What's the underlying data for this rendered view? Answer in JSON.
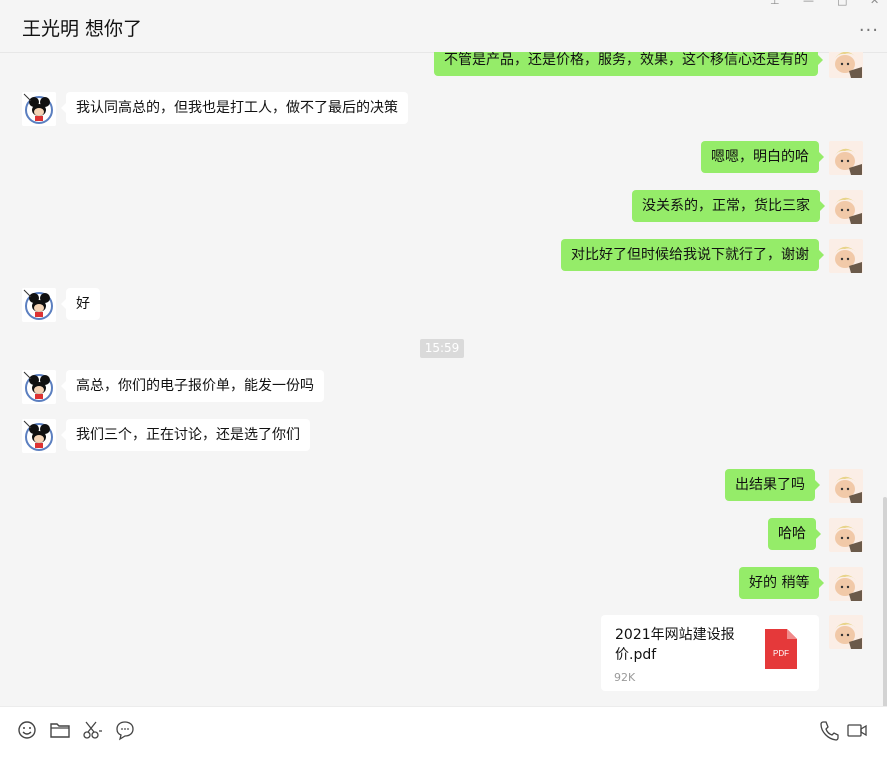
{
  "header": {
    "title": "王光明  想你了",
    "more": "···"
  },
  "messages": [
    {
      "side": "out",
      "text": "不管是产品，还是价格，服务，效果，这个移信心还是有的"
    },
    {
      "side": "in",
      "text": "我认同高总的，但我也是打工人，做不了最后的决策"
    },
    {
      "side": "out",
      "text": "嗯嗯，明白的哈"
    },
    {
      "side": "out",
      "text": "没关系的，正常，货比三家"
    },
    {
      "side": "out",
      "text": "对比好了但时候给我说下就行了，谢谢"
    },
    {
      "side": "in",
      "text": "好"
    },
    {
      "side": "in",
      "text": "高总，你们的电子报价单，能发一份吗"
    },
    {
      "side": "in",
      "text": "我们三个，正在讨论，还是选了你们"
    },
    {
      "side": "out",
      "text": "出结果了吗"
    },
    {
      "side": "out",
      "text": "哈哈"
    },
    {
      "side": "out",
      "text": "好的 稍等"
    }
  ],
  "timestamp": "15:59",
  "file": {
    "name": "2021年网站建设报价.pdf",
    "size": "92K",
    "type_label": "PDF"
  },
  "toolbar": {
    "left_icons": [
      "emoji-icon",
      "folder-icon",
      "scissors-icon",
      "chat-bubble-icon"
    ],
    "right_icons": [
      "phone-icon",
      "video-icon"
    ]
  },
  "colors": {
    "outgoing_bubble": "#95ec69",
    "incoming_bubble": "#ffffff",
    "background": "#f5f5f5",
    "pdf_red": "#e5393a"
  }
}
